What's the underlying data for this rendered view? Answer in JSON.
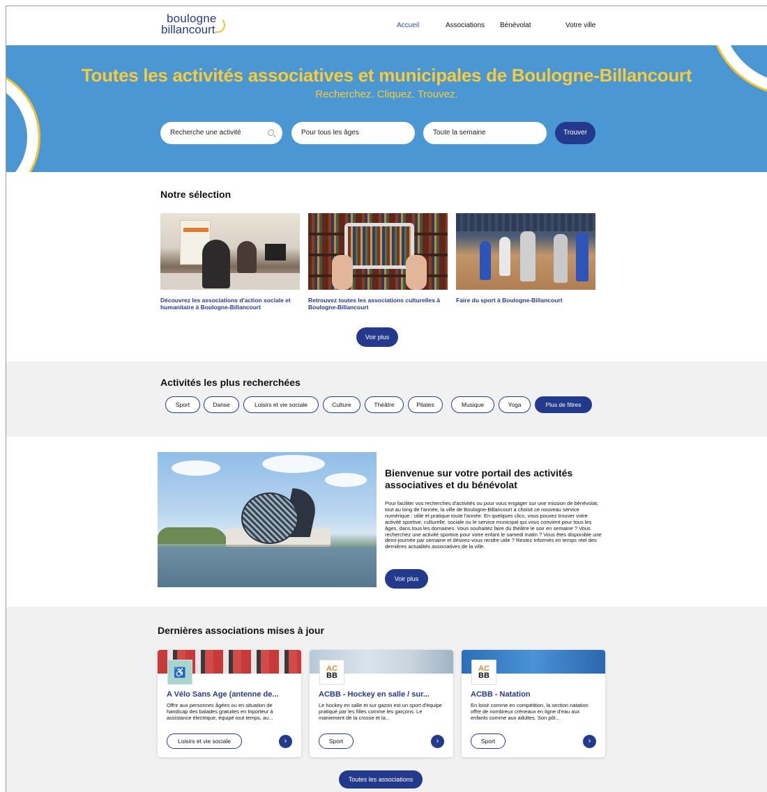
{
  "nav": {
    "logo_line1": "boulogne",
    "logo_line2": "billancourt",
    "links": [
      "Accueil",
      "Associations",
      "Bénévolat",
      "Votre ville"
    ]
  },
  "hero": {
    "title": "Toutes les activités associatives et municipales de Boulogne-Billancourt",
    "subtitle": "Recherchez. Cliquez. Trouvez.",
    "search_placeholder": "Recherche une activité",
    "age_select": "Pour tous les âges",
    "day_select": "Toute la semaine",
    "submit": "Trouver"
  },
  "selection": {
    "title": "Notre sélection",
    "cards": [
      {
        "caption": "Découvrez les associations d'action sociale et humanitaire à Boulogne-Billancourt"
      },
      {
        "caption": "Retrouvez toutes les associations culturelles à Boulogne-Billancourt"
      },
      {
        "caption": "Faire du sport à Boulogne-Billancourt"
      }
    ],
    "more": "Voir plus"
  },
  "popular": {
    "title": "Activités les plus recherchées",
    "chips": [
      "Sport",
      "Danse",
      "Loisirs et vie sociale",
      "Culture",
      "Théâtre",
      "Pilates",
      "Musique",
      "Yoga"
    ],
    "more_filters": "Plus de filtres"
  },
  "welcome": {
    "title": "Bienvenue sur votre portail des activités associatives et du bénévolat",
    "text": "Pour faciliter vos recherches d'activités ou pour vous engager sur une mission de bénévolat, tout au long de l'année, la ville de Boulogne-Billancourt a choisit ce nouveau service numérique : utile et pratique toute l'année. En quelques clics, vous pouvez trouver votre activité sportive, culturelle, sociale ou le service municipal qui vous convient pour tous les âges, dans tous les domaines. Vous souhaitez faire du théâtre le soir en semaine ? Vous recherchez une activité sportive pour votre enfant le samedi matin ? Vous êtes disponible une demi-journée par semaine et désirez-vous rendre utile ? Restez informés en temps réel des dernières actualités associatives de la ville.",
    "more": "Voir plus"
  },
  "latest": {
    "title": "Dernières associations mises à jour",
    "cards": [
      {
        "name": "A Vélo Sans Age (antenne de...",
        "desc": "Offrir aux personnes âgées ou en situation de handicap des balades gratuites en triporteur à assistance électrique, équipé tout temps, au...",
        "tag": "Loisirs et vie sociale"
      },
      {
        "name": "ACBB - Hockey en salle / sur...",
        "desc": "Le hockey en salle et sur gazon est un sport d'équipe pratiqué par les filles comme les garçons. Le maniement de la crosse et la...",
        "tag": "Sport",
        "logo_top": "AC",
        "logo_bottom": "BB"
      },
      {
        "name": "ACBB - Natation",
        "desc": "En loisir comme en compétition, la section natation offre de nombreux créneaux en ligne d'eau aux enfants comme aux adultes. Son pôl...",
        "tag": "Sport",
        "logo_top": "AC",
        "logo_bottom": "BB"
      }
    ],
    "all": "Toutes les associations"
  },
  "colors": {
    "accent": "#233a8c",
    "hero_bg": "#4b97d3",
    "hero_text": "#f7cb3c"
  }
}
